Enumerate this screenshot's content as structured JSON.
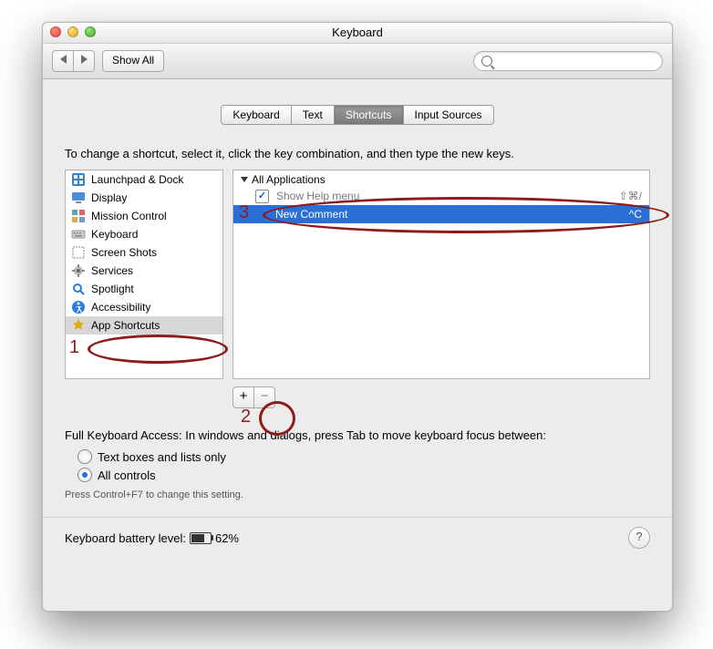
{
  "window": {
    "title": "Keyboard",
    "show_all": "Show All",
    "search_placeholder": ""
  },
  "tabs": [
    {
      "label": "Keyboard",
      "active": false
    },
    {
      "label": "Text",
      "active": false
    },
    {
      "label": "Shortcuts",
      "active": true
    },
    {
      "label": "Input Sources",
      "active": false
    }
  ],
  "instruction": "To change a shortcut, select it, click the key combination, and then type the new keys.",
  "categories": [
    {
      "label": "Launchpad & Dock",
      "icon": "launchpad-icon",
      "selected": false
    },
    {
      "label": "Display",
      "icon": "display-icon",
      "selected": false
    },
    {
      "label": "Mission Control",
      "icon": "mission-control-icon",
      "selected": false
    },
    {
      "label": "Keyboard",
      "icon": "keyboard-icon",
      "selected": false
    },
    {
      "label": "Screen Shots",
      "icon": "screenshots-icon",
      "selected": false
    },
    {
      "label": "Services",
      "icon": "services-icon",
      "selected": false
    },
    {
      "label": "Spotlight",
      "icon": "spotlight-icon",
      "selected": false
    },
    {
      "label": "Accessibility",
      "icon": "accessibility-icon",
      "selected": false
    },
    {
      "label": "App Shortcuts",
      "icon": "app-shortcuts-icon",
      "selected": true
    }
  ],
  "shortcut_group": {
    "title": "All Applications",
    "items": [
      {
        "label": "Show Help menu",
        "keys": "⇧⌘/",
        "checked": true,
        "selected": false
      },
      {
        "label": "New Comment",
        "keys": "^C",
        "checked": false,
        "selected": true
      }
    ]
  },
  "buttons": {
    "add": "+",
    "remove": "−"
  },
  "fka": {
    "label": "Full Keyboard Access: In windows and dialogs, press Tab to move keyboard focus between:",
    "opt1": "Text boxes and lists only",
    "opt2": "All controls",
    "selected": "opt2",
    "hint": "Press Control+F7 to change this setting."
  },
  "battery": {
    "label_prefix": "Keyboard battery level:",
    "percent_text": "62%",
    "percent": 62
  },
  "help": "?",
  "annotations": {
    "n1": "1",
    "n2": "2",
    "n3": "3"
  }
}
